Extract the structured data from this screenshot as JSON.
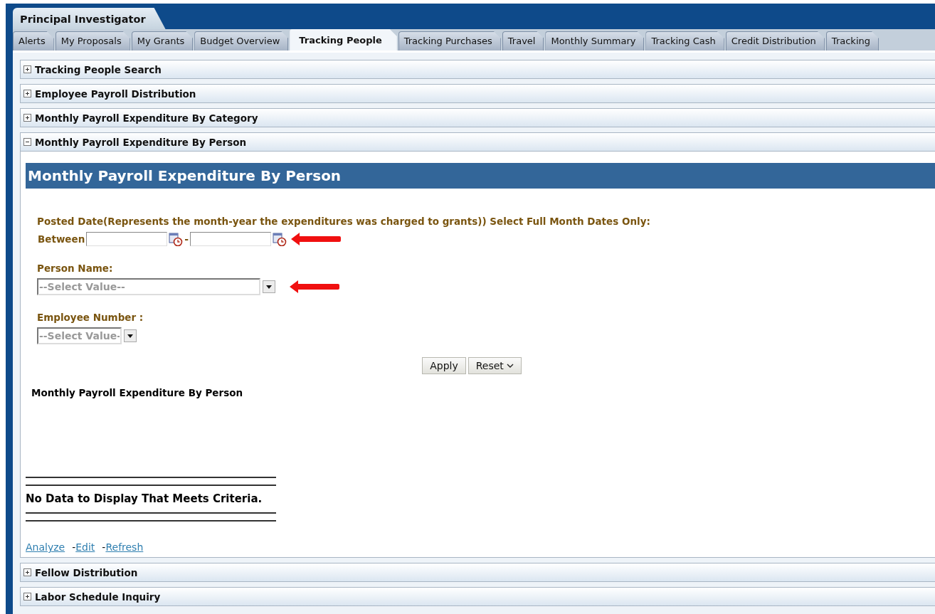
{
  "header": {
    "title": "Principal Investigator"
  },
  "tabs": [
    {
      "label": "Alerts",
      "selected": false
    },
    {
      "label": "My Proposals",
      "selected": false
    },
    {
      "label": "My Grants",
      "selected": false
    },
    {
      "label": "Budget Overview",
      "selected": false
    },
    {
      "label": "Tracking People",
      "selected": true
    },
    {
      "label": "Tracking Purchases",
      "selected": false
    },
    {
      "label": "Travel",
      "selected": false
    },
    {
      "label": "Monthly Summary",
      "selected": false
    },
    {
      "label": "Tracking Cash",
      "selected": false
    },
    {
      "label": "Credit Distribution",
      "selected": false
    },
    {
      "label": "Tracking",
      "selected": false
    }
  ],
  "sections": [
    {
      "title": "Tracking People Search",
      "expanded": false
    },
    {
      "title": "Employee Payroll Distribution",
      "expanded": false
    },
    {
      "title": "Monthly Payroll Expenditure By Category",
      "expanded": false
    },
    {
      "title": "Monthly Payroll Expenditure By Person",
      "expanded": true,
      "panel": {
        "heading": "Monthly Payroll Expenditure By Person",
        "date_prompt": "Posted Date(Represents the month-year the expenditures was charged to grants)) Select Full Month Dates Only:",
        "between_label": "Between",
        "range_separator": "-",
        "person_label": "Person Name:",
        "person_placeholder": "--Select Value--",
        "employee_label": "Employee Number :",
        "employee_placeholder": "--Select Value-",
        "buttons": [
          "Apply",
          "Reset"
        ],
        "report_title": "Monthly Payroll Expenditure By Person",
        "no_data": "No Data to Display That Meets Criteria.",
        "links": [
          {
            "label": "Analyze"
          },
          {
            "label": "Edit",
            "separator": "-"
          },
          {
            "label": "Refresh",
            "separator": "-"
          }
        ]
      }
    },
    {
      "title": "Fellow Distribution",
      "expanded": false
    },
    {
      "title": "Labor Schedule Inquiry",
      "expanded": false
    }
  ]
}
